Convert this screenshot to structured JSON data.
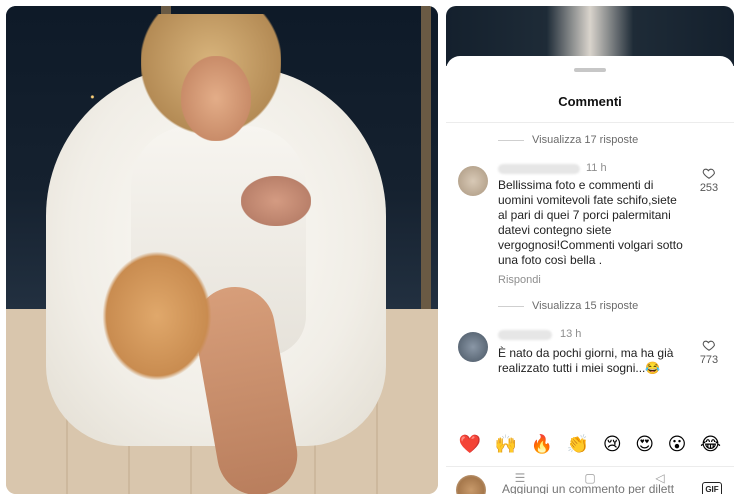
{
  "sheet": {
    "title": "Commenti"
  },
  "threads": [
    {
      "view_replies": "Visualizza 17 risposte"
    },
    {
      "view_replies": "Visualizza 15 risposte"
    }
  ],
  "comments": [
    {
      "time": "11 h",
      "text": "Bellissima foto e commenti di uomini vomitevoli fate schifo,siete al pari di quei 7 porci palermitani datevi contegno siete vergognosi!Commenti volgari sotto una foto così bella .",
      "reply_label": "Rispondi",
      "likes": "253"
    },
    {
      "time": "13 h",
      "text": "È nato da pochi giorni, ma ha già realizzato tutti i miei sogni...😂",
      "likes": "773"
    }
  ],
  "reactions": [
    "❤️",
    "🙌",
    "🔥",
    "👏",
    "😢",
    "😍",
    "😮",
    "😂"
  ],
  "composer": {
    "placeholder": "Aggiungi un commento per dilett",
    "gif_label": "GIF"
  },
  "nav": {
    "recent": "☰",
    "home": "▢",
    "back": "◁"
  }
}
